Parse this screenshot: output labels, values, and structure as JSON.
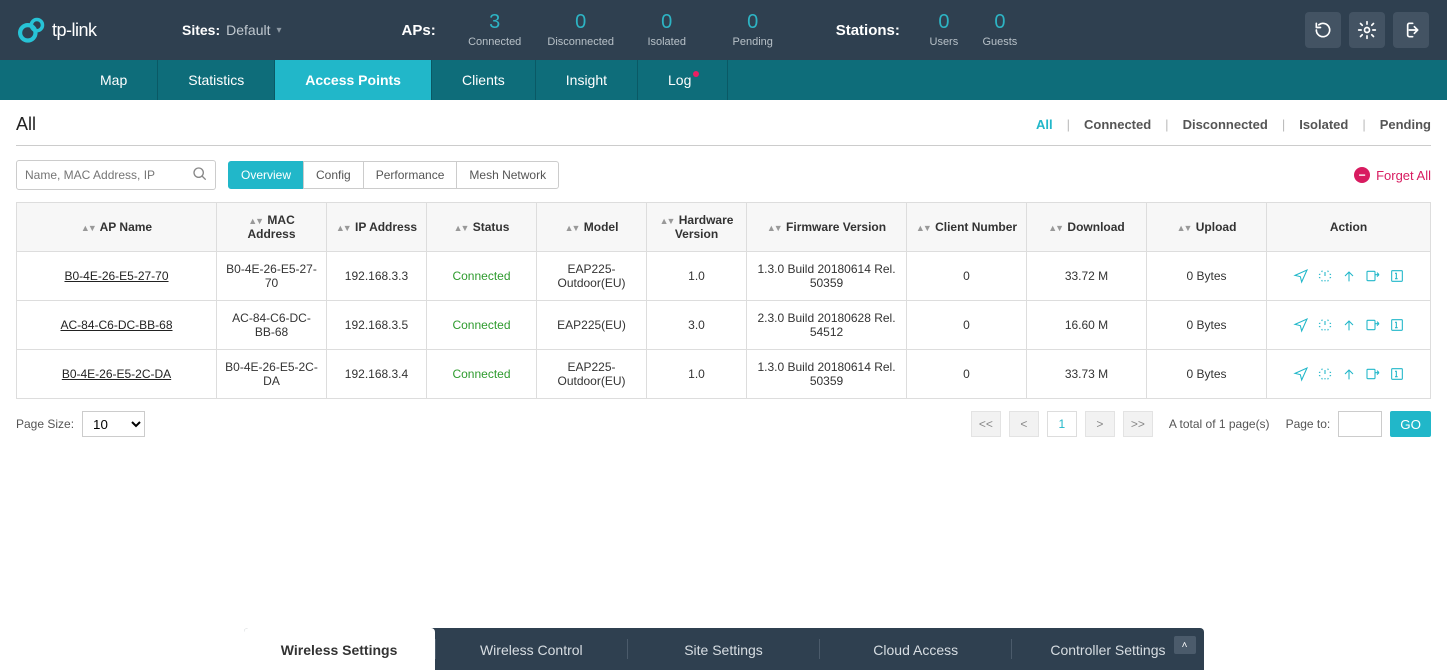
{
  "brand": "tp-link",
  "sites": {
    "label": "Sites:",
    "value": "Default"
  },
  "ap_stats": {
    "title": "APs:",
    "items": [
      {
        "value": "3",
        "label": "Connected"
      },
      {
        "value": "0",
        "label": "Disconnected"
      },
      {
        "value": "0",
        "label": "Isolated"
      },
      {
        "value": "0",
        "label": "Pending"
      }
    ]
  },
  "station_stats": {
    "title": "Stations:",
    "items": [
      {
        "value": "0",
        "label": "Users"
      },
      {
        "value": "0",
        "label": "Guests"
      }
    ]
  },
  "nav": [
    "Map",
    "Statistics",
    "Access Points",
    "Clients",
    "Insight",
    "Log"
  ],
  "nav_active": 2,
  "page_title": "All",
  "filters": [
    "All",
    "Connected",
    "Disconnected",
    "Isolated",
    "Pending"
  ],
  "filters_active": 0,
  "search_placeholder": "Name, MAC Address, IP",
  "view_tabs": [
    "Overview",
    "Config",
    "Performance",
    "Mesh Network"
  ],
  "view_tabs_active": 0,
  "forget_label": "Forget All",
  "columns": [
    "AP Name",
    "MAC Address",
    "IP Address",
    "Status",
    "Model",
    "Hardware Version",
    "Firmware Version",
    "Client Number",
    "Download",
    "Upload",
    "Action"
  ],
  "rows": [
    {
      "name": "B0-4E-26-E5-27-70",
      "mac": "B0-4E-26-E5-27-70",
      "ip": "192.168.3.3",
      "status": "Connected",
      "model": "EAP225-Outdoor(EU)",
      "hw": "1.0",
      "fw": "1.3.0 Build 20180614 Rel. 50359",
      "clients": "0",
      "down": "33.72 M",
      "up": "0 Bytes"
    },
    {
      "name": "AC-84-C6-DC-BB-68",
      "mac": "AC-84-C6-DC-BB-68",
      "ip": "192.168.3.5",
      "status": "Connected",
      "model": "EAP225(EU)",
      "hw": "3.0",
      "fw": "2.3.0 Build 20180628 Rel. 54512",
      "clients": "0",
      "down": "16.60 M",
      "up": "0 Bytes"
    },
    {
      "name": "B0-4E-26-E5-2C-DA",
      "mac": "B0-4E-26-E5-2C-DA",
      "ip": "192.168.3.4",
      "status": "Connected",
      "model": "EAP225-Outdoor(EU)",
      "hw": "1.0",
      "fw": "1.3.0 Build 20180614 Rel. 50359",
      "clients": "0",
      "down": "33.73 M",
      "up": "0 Bytes"
    }
  ],
  "pager": {
    "page_size_label": "Page Size:",
    "page_size": "10",
    "current": "1",
    "total_text": "A total of 1 page(s)",
    "goto_label": "Page to:",
    "go": "GO"
  },
  "bottom_tabs": [
    "Wireless Settings",
    "Wireless Control",
    "Site Settings",
    "Cloud Access",
    "Controller Settings"
  ],
  "bottom_active": 0
}
